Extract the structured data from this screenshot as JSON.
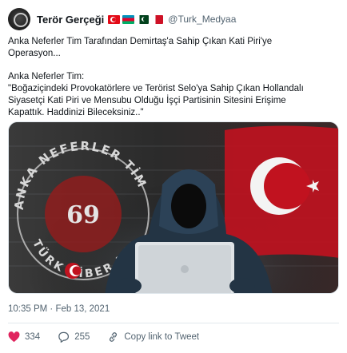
{
  "tweet": {
    "display_name": "Terör Gerçeği",
    "handle": "@Turk_Medyaa",
    "flags": [
      "turkey-flag-icon",
      "azerbaijan-flag-icon",
      "pakistan-flag-icon",
      "bahrain-flag-icon"
    ],
    "text_lines": [
      "Anka Neferler Tim Tarafından Demirtaş'a Sahip Çıkan Kati Piri'ye",
      "Operasyon...",
      "Anka Neferler Tim:",
      "\"Boğaziçindeki Provokatörlere ve Terörist Selo'ya Sahip Çıkan Hollandalı",
      "Siyasetçi Kati Piri ve Mensubu Olduğu İşçi Partisinin Sitesini Erişime",
      "Kapattık. Haddinizi Bileceksiniz..\""
    ],
    "media": {
      "emblem_text_top": "ANKA NEFERLER TİM",
      "emblem_text_bottom": "TÜRK SİBER KO",
      "emblem_center": "69",
      "description_icons": [
        "hacker-figure",
        "laptop-icon",
        "turkey-flag-icon"
      ]
    },
    "timestamp": "10:35 PM · Feb 13, 2021",
    "actions": {
      "likes": "334",
      "replies": "255",
      "copy_link_label": "Copy link to Tweet"
    }
  },
  "colors": {
    "text": "#0f1419",
    "secondary": "#536471",
    "like_red": "#e0245e",
    "flag_red": "#e30a17",
    "divider": "#e1e8ed"
  }
}
